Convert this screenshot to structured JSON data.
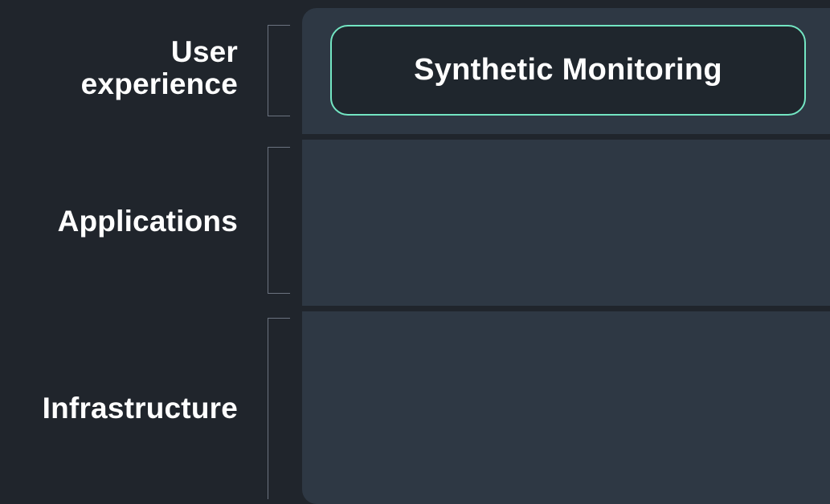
{
  "layers": {
    "user_experience": {
      "label": "User\nexperience"
    },
    "applications": {
      "label": "Applications"
    },
    "infrastructure": {
      "label": "Infrastructure"
    }
  },
  "products": {
    "user_experience": {
      "label": "Synthetic Monitoring",
      "border_color": "#73e6c3"
    }
  }
}
